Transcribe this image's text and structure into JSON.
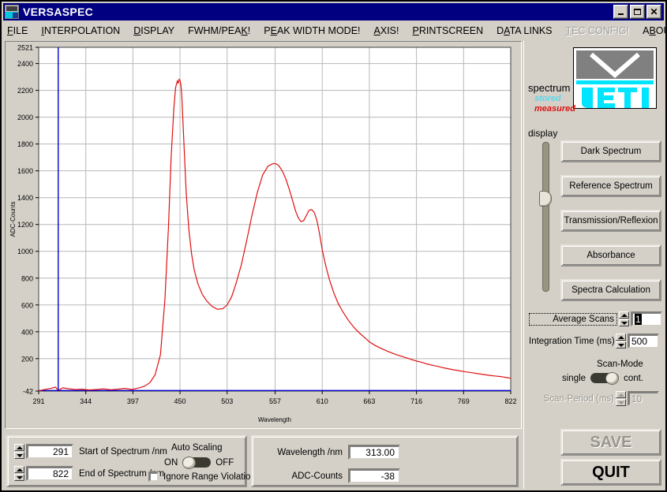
{
  "window": {
    "title": "VERSASPEC",
    "icon": "jeti-logo-icon",
    "minimize_label": "",
    "maximize_label": "",
    "close_label": "✕"
  },
  "menu": {
    "items": [
      {
        "label": "FILE",
        "mnemonic": "F",
        "disabled": false
      },
      {
        "label": "INTERPOLATION",
        "mnemonic": "I",
        "disabled": false
      },
      {
        "label": "DISPLAY",
        "mnemonic": "D",
        "disabled": false
      },
      {
        "label": "FWHM/PEAK!",
        "mnemonic": "K",
        "disabled": false
      },
      {
        "label": "PEAK WIDTH MODE!",
        "mnemonic": "E",
        "disabled": false
      },
      {
        "label": "AXIS!",
        "mnemonic": "A",
        "disabled": false
      },
      {
        "label": "PRINTSCREEN",
        "mnemonic": "P",
        "disabled": false
      },
      {
        "label": "DATA LINKS",
        "mnemonic": "A",
        "disabled": false
      },
      {
        "label": "TEC CONFIG!",
        "mnemonic": "T",
        "disabled": true
      },
      {
        "label": "ABOUT!",
        "mnemonic": "B",
        "disabled": false
      }
    ]
  },
  "legend": {
    "title": "spectrum",
    "stored_label": "stored",
    "stored_color": "#5fd5e8",
    "measured_label": "measured",
    "measured_color": "#e01010",
    "display_label": "display"
  },
  "logo": {
    "text": "JETI"
  },
  "buttons": {
    "dark_spectrum": "Dark Spectrum",
    "reference_spectrum": "Reference Spectrum",
    "transmission_reflexion": "Transmission/Reflexion",
    "absorbance": "Absorbance",
    "spectra_calculation": "Spectra Calculation",
    "save": "SAVE",
    "save_disabled": true,
    "quit": "QUIT",
    "quit_disabled": false
  },
  "acquisition": {
    "average_scans_label": "Average Scans",
    "average_scans_value": "1",
    "integration_time_label": "Integration Time (ms)",
    "integration_time_value": "500",
    "scan_mode_title": "Scan-Mode",
    "scan_mode_left": "single",
    "scan_mode_right": "cont.",
    "scan_mode_state": "single",
    "scan_period_label": "Scan-Period (ms)",
    "scan_period_value": "10",
    "scan_period_disabled": true
  },
  "range_panel": {
    "start_value": "291",
    "start_label": "Start of Spectrum  /nm",
    "end_value": "822",
    "end_label": "End of Spectrum  /nm",
    "auto_scaling_title": "Auto Scaling",
    "auto_scaling_on": "ON",
    "auto_scaling_off": "OFF",
    "auto_scaling_state": "ON",
    "ignore_range_label": "Ignore Range Violation",
    "ignore_range_checked": false
  },
  "readout_panel": {
    "wavelength_label": "Wavelength /nm",
    "wavelength_value": "313.00",
    "adc_label": "ADC-Counts",
    "adc_value": "-38"
  },
  "chart_data": {
    "type": "line",
    "title": "",
    "xlabel": "Wavelength",
    "ylabel": "ADC-Counts",
    "xlim": [
      291,
      822
    ],
    "ylim": [
      -42,
      2521
    ],
    "xticks": [
      291,
      344,
      397,
      450,
      503,
      557,
      610,
      663,
      716,
      769,
      822
    ],
    "yticks": [
      -42,
      200,
      400,
      600,
      800,
      1000,
      1200,
      1400,
      1600,
      1800,
      2000,
      2200,
      2400,
      2521
    ],
    "grid": true,
    "legend_position": "external-right",
    "cursor": {
      "x": 313.0,
      "y": -38,
      "color": "#0000d0"
    },
    "series": [
      {
        "name": "stored",
        "color": "#0000d0",
        "x": [
          291,
          822
        ],
        "values": [
          -38,
          -38
        ]
      },
      {
        "name": "measured",
        "color": "#e01010",
        "x": [
          291,
          298,
          305,
          310,
          313,
          318,
          325,
          332,
          340,
          348,
          356,
          364,
          372,
          380,
          388,
          396,
          404,
          410,
          416,
          422,
          428,
          433,
          437,
          440,
          443,
          445,
          447,
          448,
          449,
          450,
          451,
          452,
          453,
          455,
          457,
          460,
          463,
          466,
          470,
          475,
          480,
          486,
          492,
          498,
          503,
          508,
          513,
          519,
          525,
          531,
          537,
          543,
          549,
          554,
          557,
          561,
          565,
          569,
          573,
          577,
          580,
          583,
          586,
          589,
          592,
          595,
          598,
          601,
          604,
          607,
          610,
          614,
          618,
          623,
          628,
          634,
          640,
          646,
          652,
          658,
          663,
          669,
          675,
          681,
          687,
          693,
          699,
          705,
          711,
          716,
          722,
          728,
          734,
          740,
          746,
          752,
          758,
          764,
          769,
          775,
          781,
          787,
          793,
          799,
          805,
          811,
          816,
          822
        ],
        "values": [
          -40,
          -30,
          -22,
          -12,
          -38,
          -18,
          -25,
          -30,
          -28,
          -34,
          -30,
          -26,
          -32,
          -28,
          -22,
          -30,
          -18,
          -6,
          20,
          80,
          230,
          640,
          1180,
          1700,
          2060,
          2220,
          2270,
          2255,
          2282,
          2275,
          2240,
          2160,
          2010,
          1720,
          1430,
          1160,
          980,
          860,
          760,
          680,
          630,
          590,
          568,
          572,
          600,
          660,
          760,
          900,
          1080,
          1270,
          1440,
          1570,
          1635,
          1652,
          1655,
          1640,
          1600,
          1540,
          1460,
          1370,
          1300,
          1250,
          1222,
          1228,
          1265,
          1305,
          1312,
          1290,
          1230,
          1130,
          1010,
          890,
          790,
          690,
          610,
          540,
          480,
          430,
          390,
          355,
          325,
          300,
          280,
          262,
          245,
          230,
          218,
          205,
          192,
          182,
          172,
          160,
          150,
          142,
          132,
          124,
          116,
          110,
          104,
          98,
          92,
          86,
          80,
          74,
          70,
          66,
          60,
          54,
          48,
          42,
          36,
          30
        ]
      }
    ]
  }
}
